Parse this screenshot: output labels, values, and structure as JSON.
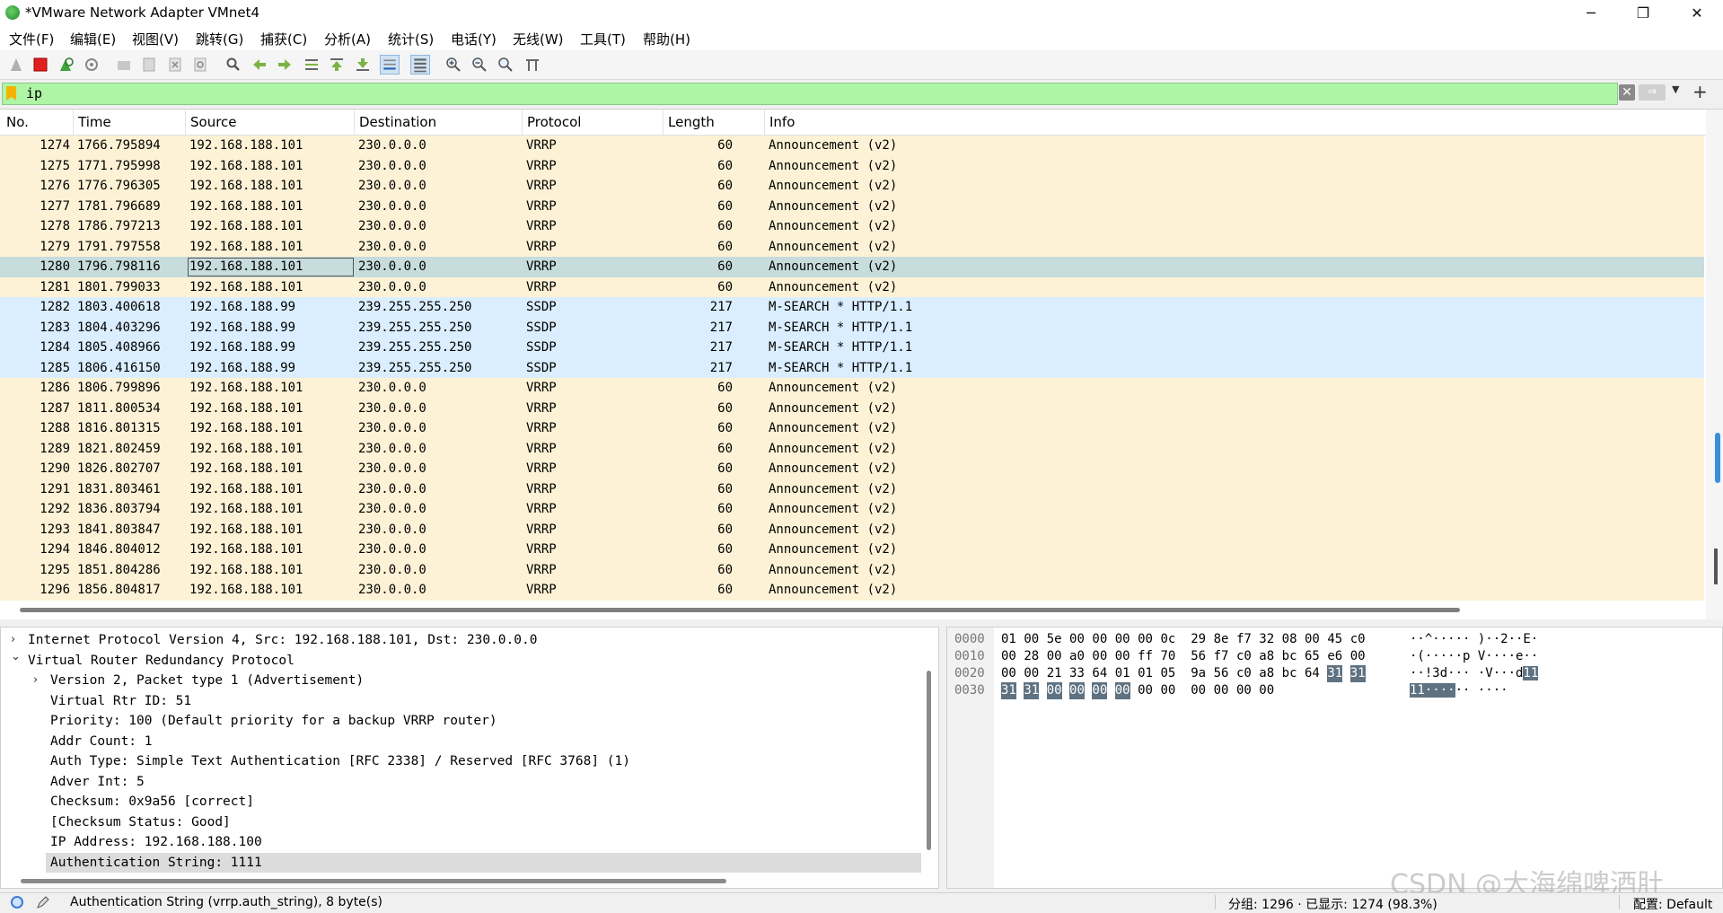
{
  "window": {
    "title": "*VMware Network Adapter VMnet4",
    "minimize": "─",
    "restore": "❐",
    "close": "✕"
  },
  "menu": [
    "文件(F)",
    "编辑(E)",
    "视图(V)",
    "跳转(G)",
    "捕获(C)",
    "分析(A)",
    "统计(S)",
    "电话(Y)",
    "无线(W)",
    "工具(T)",
    "帮助(H)"
  ],
  "filter": {
    "value": "ip",
    "clear_icon": "✕",
    "apply_icon": "⇒",
    "dropdown_icon": "▼",
    "add_icon": "+"
  },
  "packet_list": {
    "columns": [
      "No.",
      "Time",
      "Source",
      "Destination",
      "Protocol",
      "Length",
      "Info"
    ],
    "rows": [
      {
        "no": "1274",
        "time": "1766.795894",
        "src": "192.168.188.101",
        "dst": "230.0.0.0",
        "proto": "VRRP",
        "len": "60",
        "info": "Announcement (v2)"
      },
      {
        "no": "1275",
        "time": "1771.795998",
        "src": "192.168.188.101",
        "dst": "230.0.0.0",
        "proto": "VRRP",
        "len": "60",
        "info": "Announcement (v2)"
      },
      {
        "no": "1276",
        "time": "1776.796305",
        "src": "192.168.188.101",
        "dst": "230.0.0.0",
        "proto": "VRRP",
        "len": "60",
        "info": "Announcement (v2)"
      },
      {
        "no": "1277",
        "time": "1781.796689",
        "src": "192.168.188.101",
        "dst": "230.0.0.0",
        "proto": "VRRP",
        "len": "60",
        "info": "Announcement (v2)"
      },
      {
        "no": "1278",
        "time": "1786.797213",
        "src": "192.168.188.101",
        "dst": "230.0.0.0",
        "proto": "VRRP",
        "len": "60",
        "info": "Announcement (v2)"
      },
      {
        "no": "1279",
        "time": "1791.797558",
        "src": "192.168.188.101",
        "dst": "230.0.0.0",
        "proto": "VRRP",
        "len": "60",
        "info": "Announcement (v2)"
      },
      {
        "no": "1280",
        "time": "1796.798116",
        "src": "192.168.188.101",
        "dst": "230.0.0.0",
        "proto": "VRRP",
        "len": "60",
        "info": "Announcement (v2)",
        "selected": true
      },
      {
        "no": "1281",
        "time": "1801.799033",
        "src": "192.168.188.101",
        "dst": "230.0.0.0",
        "proto": "VRRP",
        "len": "60",
        "info": "Announcement (v2)"
      },
      {
        "no": "1282",
        "time": "1803.400618",
        "src": "192.168.188.99",
        "dst": "239.255.255.250",
        "proto": "SSDP",
        "len": "217",
        "info": "M-SEARCH * HTTP/1.1"
      },
      {
        "no": "1283",
        "time": "1804.403296",
        "src": "192.168.188.99",
        "dst": "239.255.255.250",
        "proto": "SSDP",
        "len": "217",
        "info": "M-SEARCH * HTTP/1.1"
      },
      {
        "no": "1284",
        "time": "1805.408966",
        "src": "192.168.188.99",
        "dst": "239.255.255.250",
        "proto": "SSDP",
        "len": "217",
        "info": "M-SEARCH * HTTP/1.1"
      },
      {
        "no": "1285",
        "time": "1806.416150",
        "src": "192.168.188.99",
        "dst": "239.255.255.250",
        "proto": "SSDP",
        "len": "217",
        "info": "M-SEARCH * HTTP/1.1"
      },
      {
        "no": "1286",
        "time": "1806.799896",
        "src": "192.168.188.101",
        "dst": "230.0.0.0",
        "proto": "VRRP",
        "len": "60",
        "info": "Announcement (v2)"
      },
      {
        "no": "1287",
        "time": "1811.800534",
        "src": "192.168.188.101",
        "dst": "230.0.0.0",
        "proto": "VRRP",
        "len": "60",
        "info": "Announcement (v2)"
      },
      {
        "no": "1288",
        "time": "1816.801315",
        "src": "192.168.188.101",
        "dst": "230.0.0.0",
        "proto": "VRRP",
        "len": "60",
        "info": "Announcement (v2)"
      },
      {
        "no": "1289",
        "time": "1821.802459",
        "src": "192.168.188.101",
        "dst": "230.0.0.0",
        "proto": "VRRP",
        "len": "60",
        "info": "Announcement (v2)"
      },
      {
        "no": "1290",
        "time": "1826.802707",
        "src": "192.168.188.101",
        "dst": "230.0.0.0",
        "proto": "VRRP",
        "len": "60",
        "info": "Announcement (v2)"
      },
      {
        "no": "1291",
        "time": "1831.803461",
        "src": "192.168.188.101",
        "dst": "230.0.0.0",
        "proto": "VRRP",
        "len": "60",
        "info": "Announcement (v2)"
      },
      {
        "no": "1292",
        "time": "1836.803794",
        "src": "192.168.188.101",
        "dst": "230.0.0.0",
        "proto": "VRRP",
        "len": "60",
        "info": "Announcement (v2)"
      },
      {
        "no": "1293",
        "time": "1841.803847",
        "src": "192.168.188.101",
        "dst": "230.0.0.0",
        "proto": "VRRP",
        "len": "60",
        "info": "Announcement (v2)"
      },
      {
        "no": "1294",
        "time": "1846.804012",
        "src": "192.168.188.101",
        "dst": "230.0.0.0",
        "proto": "VRRP",
        "len": "60",
        "info": "Announcement (v2)"
      },
      {
        "no": "1295",
        "time": "1851.804286",
        "src": "192.168.188.101",
        "dst": "230.0.0.0",
        "proto": "VRRP",
        "len": "60",
        "info": "Announcement (v2)"
      },
      {
        "no": "1296",
        "time": "1856.804817",
        "src": "192.168.188.101",
        "dst": "230.0.0.0",
        "proto": "VRRP",
        "len": "60",
        "info": "Announcement (v2)"
      }
    ]
  },
  "details": [
    {
      "level": 0,
      "expander": "collapsed",
      "text": "Internet Protocol Version 4, Src: 192.168.188.101, Dst: 230.0.0.0"
    },
    {
      "level": 0,
      "expander": "expanded",
      "text": "Virtual Router Redundancy Protocol"
    },
    {
      "level": 1,
      "expander": "collapsed",
      "text": "Version 2, Packet type 1 (Advertisement)"
    },
    {
      "level": 1,
      "expander": "none",
      "text": "Virtual Rtr ID: 51"
    },
    {
      "level": 1,
      "expander": "none",
      "text": "Priority: 100 (Default priority for a backup VRRP router)"
    },
    {
      "level": 1,
      "expander": "none",
      "text": "Addr Count: 1"
    },
    {
      "level": 1,
      "expander": "none",
      "text": "Auth Type: Simple Text Authentication [RFC 2338] / Reserved [RFC 3768] (1)"
    },
    {
      "level": 1,
      "expander": "none",
      "text": "Adver Int: 5"
    },
    {
      "level": 1,
      "expander": "none",
      "text": "Checksum: 0x9a56 [correct]"
    },
    {
      "level": 1,
      "expander": "none",
      "text": "[Checksum Status: Good]"
    },
    {
      "level": 1,
      "expander": "none",
      "text": "IP Address: 192.168.188.100"
    },
    {
      "level": 1,
      "expander": "none",
      "text": "Authentication String: 1111",
      "selected": true
    }
  ],
  "hex": {
    "rows": [
      {
        "offset": "0000",
        "bytes": [
          "01",
          "00",
          "5e",
          "00",
          "00",
          "00",
          "00",
          "0c",
          "29",
          "8e",
          "f7",
          "32",
          "08",
          "00",
          "45",
          "c0"
        ],
        "ascii": "··^····· )··2··E·"
      },
      {
        "offset": "0010",
        "bytes": [
          "00",
          "28",
          "00",
          "a0",
          "00",
          "00",
          "ff",
          "70",
          "56",
          "f7",
          "c0",
          "a8",
          "bc",
          "65",
          "e6",
          "00"
        ],
        "ascii": "·(·····p V····e··"
      },
      {
        "offset": "0020",
        "bytes": [
          "00",
          "00",
          "21",
          "33",
          "64",
          "01",
          "01",
          "05",
          "9a",
          "56",
          "c0",
          "a8",
          "bc",
          "64",
          "31",
          "31"
        ],
        "ascii": "··!3d··· ·V···d11"
      },
      {
        "offset": "0030",
        "bytes": [
          "31",
          "31",
          "00",
          "00",
          "00",
          "00",
          "00",
          "00",
          "00",
          "00",
          "00",
          "00"
        ],
        "ascii": "11······ ····"
      }
    ],
    "highlight_bytes": {
      "0020": [
        14,
        15
      ],
      "0030": [
        0,
        1,
        2,
        3,
        4,
        5
      ]
    },
    "highlight_ascii": {
      "0020": "11",
      "0030": "11····"
    }
  },
  "watermark": "CSDN @大海绵啤酒肚",
  "status": {
    "field_text": "Authentication String (vrrp.auth_string), 8 byte(s)",
    "packets": "分组: 1296 · 已显示: 1274 (98.3%)",
    "profile": "配置: Default"
  },
  "colors": {
    "vrrp_row": "#fdf2d5",
    "ssdp_row": "#daeeff",
    "selected_row": "#c7dcdc",
    "filter_valid": "#aff5a6",
    "hex_highlight": "#5f7281"
  }
}
